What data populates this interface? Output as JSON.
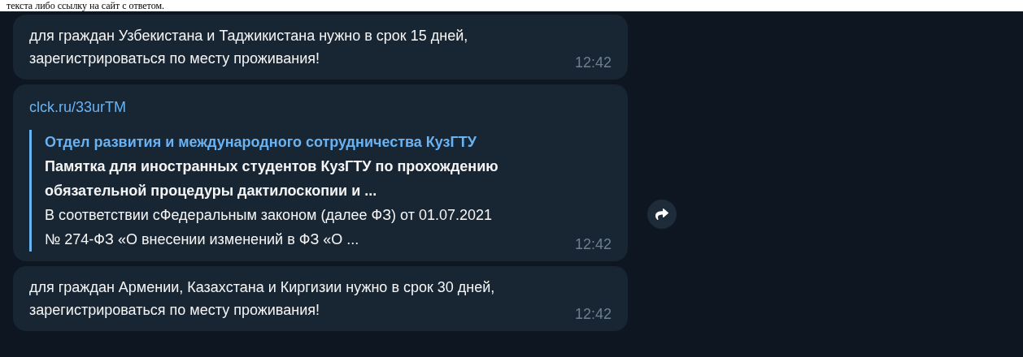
{
  "page_text": "текста либо ссылку на сайт с ответом.",
  "messages": [
    {
      "kind": "text",
      "text": "для граждан Узбекистана и Таджикистана нужно в срок 15 дней, зарегистрироваться по месту проживания!",
      "time": "12:42"
    },
    {
      "kind": "link",
      "url": "clck.ru/33urTM",
      "preview": {
        "site": "Отдел развития и международного сотрудничества КузГТУ",
        "title": "Памятка для иностранных студентов КузГТУ по прохождению обязательной процедуры дактилоскопии и ...",
        "description": "В соответствии сФедеральным законом (далее ФЗ) от 01.07.2021 № 274-ФЗ «О внесении изменений в ФЗ «О ..."
      },
      "time": "12:42"
    },
    {
      "kind": "text",
      "text": "для граждан Армении, Казахстана и Киргизии нужно в срок 30 дней, зарегистрироваться по месту проживания!",
      "time": "12:42"
    }
  ]
}
